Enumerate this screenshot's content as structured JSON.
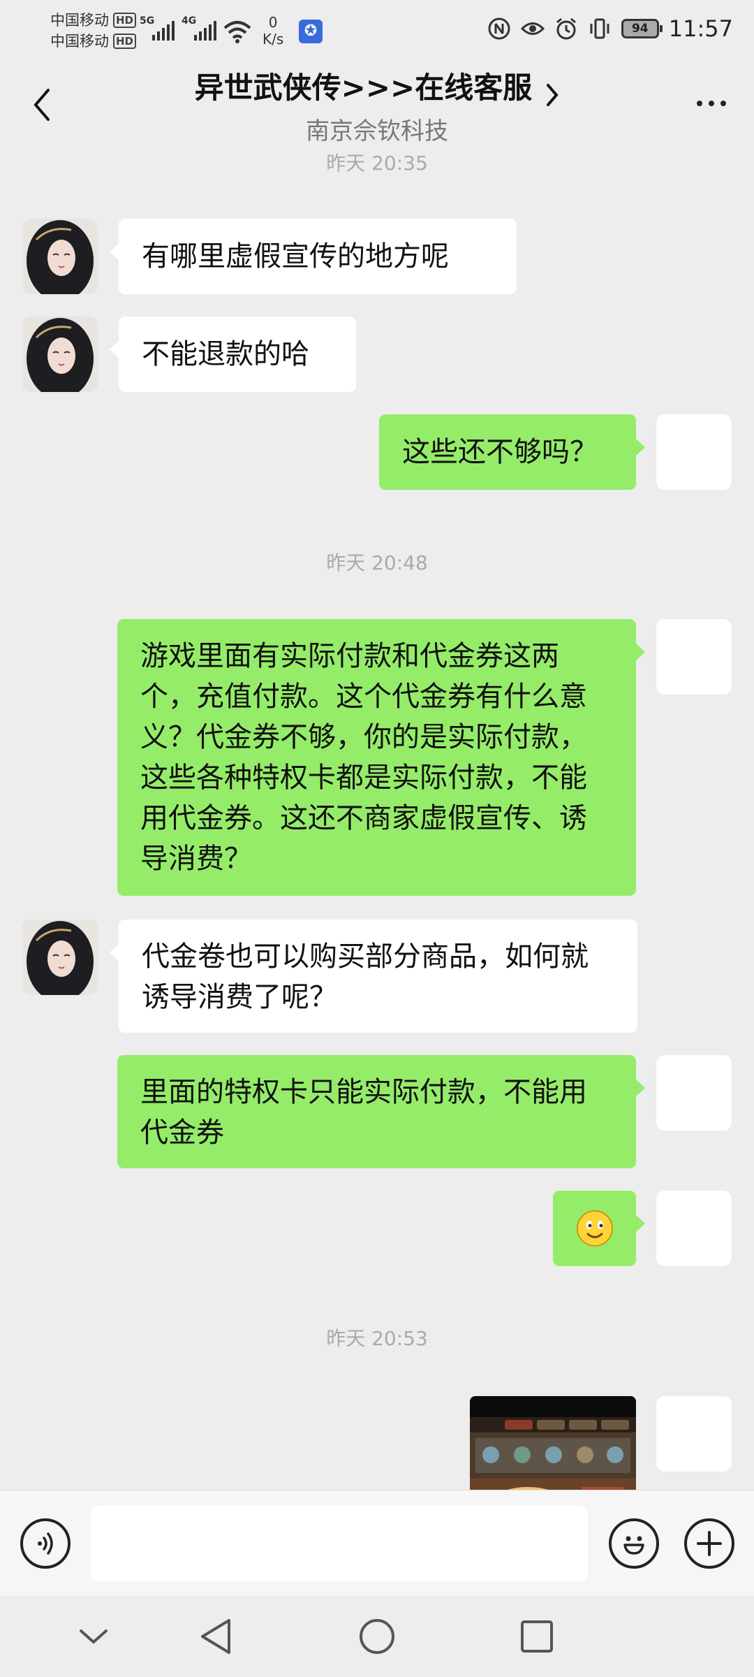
{
  "status_bar": {
    "carrier1": "中国移动",
    "carrier2": "中国移动",
    "hd_label": "HD",
    "sig1_tag": "5G",
    "sig2_tag": "4G",
    "speed_value": "0",
    "speed_unit": "K/s",
    "battery": "94",
    "time": "11:57",
    "icons": [
      "nfc-icon",
      "eye-icon",
      "alarm-icon",
      "vibrate-icon",
      "battery-icon"
    ]
  },
  "header": {
    "title": "异世武侠传>>>在线客服",
    "subtitle": "南京佘钦科技"
  },
  "chat": {
    "timestamps": [
      "昨天 20:35",
      "昨天 20:48",
      "昨天 20:53"
    ],
    "messages": [
      {
        "from": "agent",
        "text": "有哪里虚假宣传的地方呢"
      },
      {
        "from": "agent",
        "text": "不能退款的哈"
      },
      {
        "from": "user",
        "text": "这些还不够吗？"
      },
      {
        "from": "user",
        "text": "游戏里面有实际付款和代金券这两个，充值付款。这个代金券有什么意义？代金券不够，你的是实际付款，这些各种特权卡都是实际付款，不能用代金券。这还不商家虚假宣传、诱导消费？"
      },
      {
        "from": "agent",
        "text": "代金卷也可以购买部分商品，如何就诱导消费了呢？"
      },
      {
        "from": "user",
        "text": "里面的特权卡只能实际付款，不能用代金券"
      },
      {
        "from": "user",
        "emoji": "smile-emoji"
      },
      {
        "from": "user",
        "image": "game-screenshot-thumbnail"
      }
    ]
  },
  "input_bar": {
    "text_value": "",
    "icons": [
      "voice-mode-icon",
      "mic-icon",
      "emoji-icon",
      "plus-icon"
    ]
  },
  "nav_bar": {
    "icons": [
      "hide-keyboard-icon",
      "back-triangle-icon",
      "home-circle-icon",
      "recents-square-icon"
    ]
  },
  "colors": {
    "background": "#ededed",
    "outgoing_bubble": "#95ec69",
    "incoming_bubble": "#ffffff",
    "timestamp": "#aaaaaa"
  }
}
